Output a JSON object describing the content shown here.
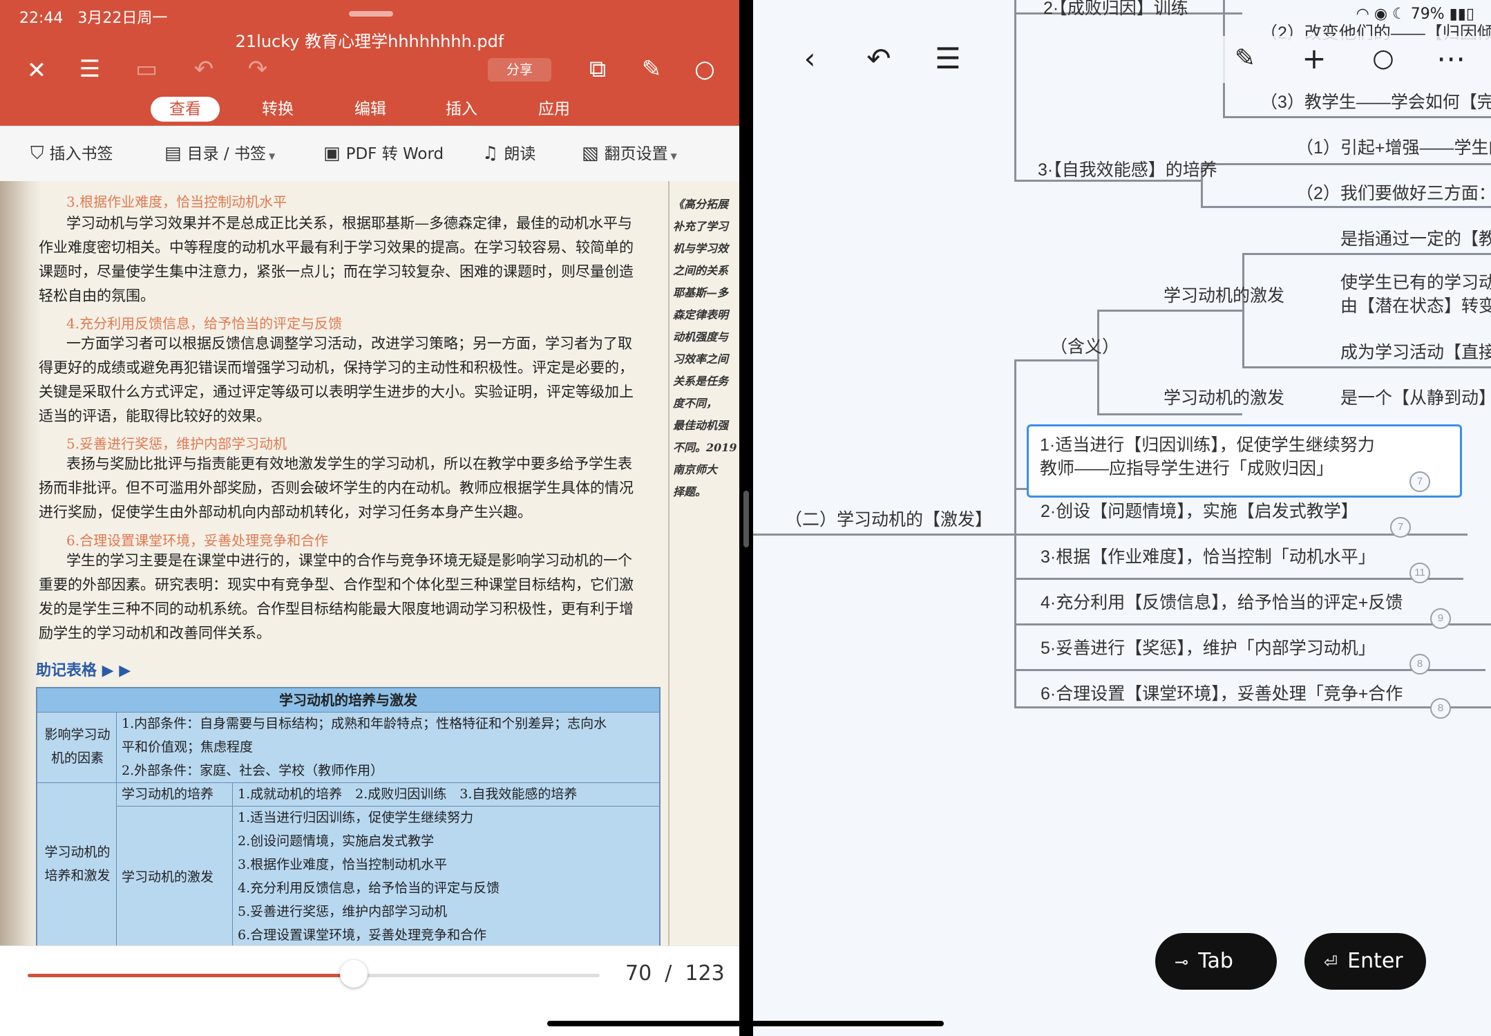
{
  "status_left": {
    "time": "22:44",
    "date": "3月22日周一"
  },
  "status_right": {
    "battery": "79%"
  },
  "pdf": {
    "title": "21lucky 教育心理学hhhhhhhh.pdf",
    "share": "分享",
    "tabs": [
      "查看",
      "转换",
      "编辑",
      "插入",
      "应用"
    ],
    "subtools": [
      "插入书签",
      "目录 / 书签",
      "PDF 转 Word",
      "朗读",
      "翻页设置"
    ],
    "page_current": "70",
    "page_sep": "/",
    "page_total": "123",
    "page_progress": 0.57
  },
  "page": {
    "h3": "3.根据作业难度，恰当控制动机水平",
    "p3": [
      "学习动机与学习效果并不是总成正比关系，根据耶基斯—多德森定律，最佳的动机水平与",
      "作业难度密切相关。中等程度的动机水平最有利于学习效果的提高。在学习较容易、较简单的",
      "课题时，尽量使学生集中注意力，紧张一点儿；而在学习较复杂、困难的课题时，则尽量创造",
      "轻松自由的氛围。"
    ],
    "h4": "4.充分利用反馈信息，给予恰当的评定与反馈",
    "p4": [
      "一方面学习者可以根据反馈信息调整学习活动，改进学习策略；另一方面，学习者为了取",
      "得更好的成绩或避免再犯错误而增强学习动机，保持学习的主动性和积极性。评定是必要的，",
      "关键是采取什么方式评定，通过评定等级可以表明学生进步的大小。实验证明，评定等级加上",
      "适当的评语，能取得比较好的效果。"
    ],
    "h5": "5.妥善进行奖惩，维护内部学习动机",
    "p5": [
      "表扬与奖励比批评与指责能更有效地激发学生的学习动机，所以在教学中要多给予学生表",
      "扬而非批评。但不可滥用外部奖励，否则会破坏学生的内在动机。教师应根据学生具体的情况",
      "进行奖励，促使学生由外部动机向内部动机转化，对学习任务本身产生兴趣。"
    ],
    "h6": "6.合理设置课堂环境，妥善处理竞争和合作",
    "p6": [
      "学生的学习主要是在课堂中进行的，课堂中的合作与竞争环境无疑是影响学习动机的一个",
      "重要的外部因素。研究表明：现实中有竞争型、合作型和个体化型三种课堂目标结构，它们激",
      "发的是学生三种不同的动机系统。合作型目标结构能最大限度地调动学习积极性，更有利于增",
      "励学生的学习动机和改善同伴关系。"
    ],
    "sidenote": [
      "《高分拓展",
      "补充了学习",
      "机与学习效",
      "之间的关系",
      "耶基斯—多",
      "森定律表明",
      "动机强度与",
      "习效率之间",
      "关系是任务",
      "度不同，",
      "最佳动机强",
      "不同。2019",
      "南京师大",
      "择题。"
    ],
    "mem_label": "助记表格 ▶ ▶",
    "table": {
      "title": "学习动机的培养与激发",
      "factors_label": [
        "影响学习动",
        "机的因素"
      ],
      "factors": [
        "1.内部条件：自身需要与目标结构；成熟和年龄特点；性格特征和个别差异；志向水",
        "平和价值观；焦虑程度",
        "2.外部条件：家庭、社会、学校（教师作用）"
      ],
      "cultivate_label": [
        "学习动机的",
        "培养和激发"
      ],
      "cultivate_sub": "学习动机的培养",
      "cultivate_items": "1.成就动机的培养　2.成败归因训练　3.自我效能感的培养",
      "stimulate_sub": "学习动机的激发",
      "stimulate_items": [
        "1.适当进行归因训练，促使学生继续努力",
        "2.创设问题情境，实施启发式教学",
        "3.根据作业难度，恰当控制动机水平",
        "4.充分利用反馈信息，给予恰当的评定与反馈",
        "5.妥善进行奖惩，维护内部学习动机",
        "6.合理设置课堂环境，妥善处理竞争和合作"
      ]
    }
  },
  "mindmap": {
    "n_top": "2·【成败归因】训练",
    "n_change": "（2）改变他们的——【归因倾",
    "n_teach": "（3）教学生——学会如何【完",
    "n_self": "3·【自我效能感】的培养",
    "n_self1": "（1）引起+增强——学生的",
    "n_self2": "（2）我们要做好三方面：",
    "n_def": "（含义）",
    "n_stim1": "学习动机的激发",
    "n_stim2": "学习动机的激发",
    "n_def1": "是指通过一定的【教",
    "n_def2a": "使学生已有的学习动",
    "n_def2b": "由【潜在状态】转变",
    "n_def3": "成为学习活动【直接",
    "n_def4": "是一个【从静到动】",
    "root": "（二）学习动机的【激发】",
    "sel_line1": "1·适当进行【归因训练】，促使学生继续努力",
    "sel_line2": "教师——应指导学生进行「成败归因」",
    "items": [
      {
        "text": "2·创设【问题情境】，实施【启发式教学】",
        "count": "7"
      },
      {
        "text": "3·根据【作业难度】，恰当控制「动机水平」",
        "count": "11"
      },
      {
        "text": "4·充分利用【反馈信息】，给予恰当的评定+反馈",
        "count": "9"
      },
      {
        "text": "5·妥善进行【奖惩】，维护「内部学习动机」",
        "count": "8"
      },
      {
        "text": "6·合理设置【课堂环境】，妥善处理「竞争+合作",
        "count": "8"
      }
    ],
    "sel_count": "7",
    "tab_label": "Tab",
    "enter_label": "Enter"
  }
}
